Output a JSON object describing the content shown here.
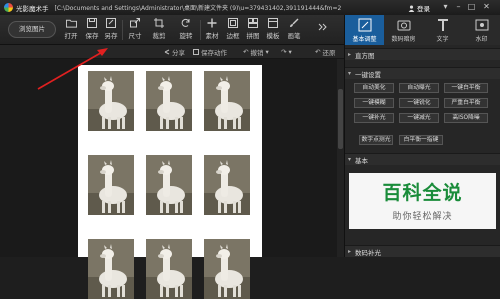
{
  "titlebar": {
    "app_title": "光影魔术手",
    "file_path": "[C:\\Documents and Settings\\Administrator\\桌面\\新建文件夹 (9)\\u=379431402,391191444&fm=2",
    "login": "登录"
  },
  "toolbar": {
    "browse": "浏览图片",
    "tools": [
      {
        "label": "打开",
        "icon": "folder-icon"
      },
      {
        "label": "保存",
        "icon": "save-icon"
      },
      {
        "label": "另存",
        "icon": "save-as-icon"
      },
      {
        "label": "尺寸",
        "icon": "resize-icon"
      },
      {
        "label": "裁剪",
        "icon": "crop-icon"
      },
      {
        "label": "旋转",
        "icon": "rotate-icon"
      },
      {
        "label": "素材",
        "icon": "material-icon"
      },
      {
        "label": "边框",
        "icon": "border-icon"
      },
      {
        "label": "拼图",
        "icon": "collage-icon"
      },
      {
        "label": "模板",
        "icon": "template-icon"
      },
      {
        "label": "画笔",
        "icon": "brush-icon"
      }
    ]
  },
  "subbar": {
    "share": "分享",
    "save_action": "保存动作",
    "undo": "撤销",
    "redo": "",
    "restore": "还原"
  },
  "right_panel": {
    "tabs": [
      {
        "label": "基本调整",
        "icon": "adjust-icon"
      },
      {
        "label": "数码暗房",
        "icon": "darkroom-icon"
      },
      {
        "label": "文字",
        "icon": "text-icon"
      },
      {
        "label": "水印",
        "icon": "watermark-icon"
      }
    ],
    "histogram": "直方图",
    "one_click": "一键设置",
    "buttons": [
      [
        "自动美化",
        "自动曝光",
        "一键白平衡"
      ],
      [
        "一键模糊",
        "一键锐化",
        "严重白平衡"
      ],
      [
        "一键补光",
        "一键减光",
        "高ISO降噪"
      ]
    ],
    "extra_buttons": [
      "数字点测光",
      "白平衡一指键"
    ],
    "basic": "基本",
    "digital_fill": "数码补光"
  },
  "watermark": {
    "title": "百科全说",
    "subtitle": "助你轻松解决"
  },
  "colors": {
    "accent_tab": "#1a5e9c",
    "arrow": "#e02020",
    "watermark_green": "#1a8c3a"
  }
}
